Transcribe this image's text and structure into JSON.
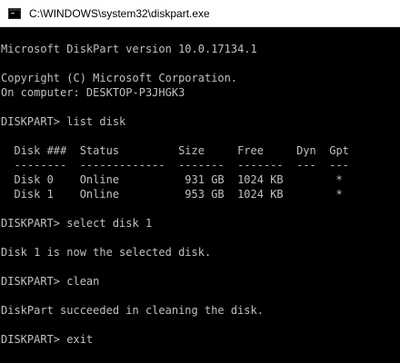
{
  "window": {
    "title": "C:\\WINDOWS\\system32\\diskpart.exe",
    "icon": "console-app-icon"
  },
  "console": {
    "lines": [
      "Microsoft DiskPart version 10.0.17134.1",
      "",
      "Copyright (C) Microsoft Corporation.",
      "On computer: DESKTOP-P3JHGK3",
      "",
      "DISKPART> list disk",
      "",
      "  Disk ###  Status         Size     Free     Dyn  Gpt",
      "  --------  -------------  -------  -------  ---  ---",
      "  Disk 0    Online          931 GB  1024 KB        *",
      "  Disk 1    Online          953 GB  1024 KB        *",
      "",
      "DISKPART> select disk 1",
      "",
      "Disk 1 is now the selected disk.",
      "",
      "DISKPART> clean",
      "",
      "DiskPart succeeded in cleaning the disk.",
      "",
      "DISKPART> exit"
    ]
  },
  "colors": {
    "console_background": "#000000",
    "console_text": "#c0c0c0",
    "titlebar_background": "#ffffff"
  }
}
